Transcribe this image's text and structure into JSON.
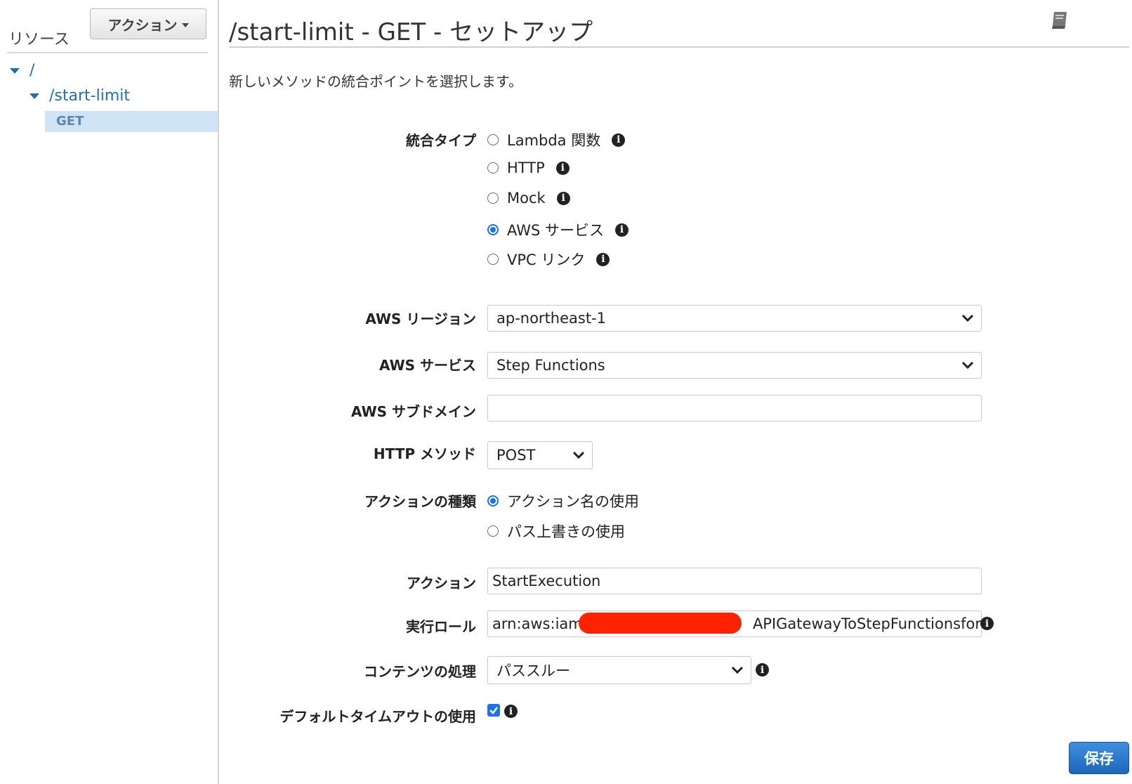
{
  "sidebar": {
    "title": "リソース",
    "action_button": "アクション",
    "tree": [
      {
        "label": "/"
      },
      {
        "label": "/start-limit"
      },
      {
        "label": "GET",
        "selected": true
      }
    ]
  },
  "main": {
    "title": "/start-limit - GET - セットアップ",
    "subtitle": "新しいメソッドの統合ポイントを選択します。",
    "integration_type": {
      "label": "統合タイプ",
      "options": [
        {
          "label": "Lambda 関数",
          "selected": false
        },
        {
          "label": "HTTP",
          "selected": false
        },
        {
          "label": "Mock",
          "selected": false
        },
        {
          "label": "AWS サービス",
          "selected": true
        },
        {
          "label": "VPC リンク",
          "selected": false
        }
      ]
    },
    "region": {
      "label": "AWS リージョン",
      "value": "ap-northeast-1"
    },
    "service": {
      "label": "AWS サービス",
      "value": "Step Functions"
    },
    "subdomain": {
      "label": "AWS サブドメイン",
      "value": ""
    },
    "http_method": {
      "label": "HTTP メソッド",
      "value": "POST"
    },
    "action_type": {
      "label": "アクションの種類",
      "options": [
        {
          "label": "アクション名の使用",
          "selected": true
        },
        {
          "label": "パス上書きの使用",
          "selected": false
        }
      ]
    },
    "action": {
      "label": "アクション",
      "value": "StartExecution"
    },
    "exec_role": {
      "label": "実行ロール",
      "value_prefix": "arn:aws:iam::",
      "value_suffix": "APIGatewayToStepFunctionsfor"
    },
    "content_handling": {
      "label": "コンテンツの処理",
      "value": "パススルー"
    },
    "default_timeout": {
      "label": "デフォルトタイムアウトの使用",
      "checked": true
    },
    "save_button": "保存"
  },
  "colors": {
    "accent": "#1a73e8",
    "link": "#1f6fb5",
    "selected_bg": "#cfe5f7",
    "redaction": "#ff2200"
  }
}
